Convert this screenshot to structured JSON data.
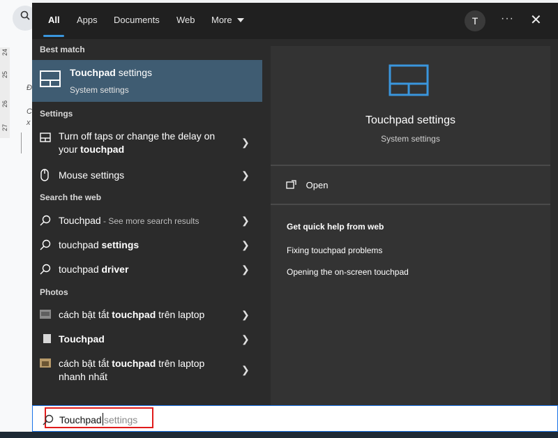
{
  "background": {
    "ruler_numbers": [
      "24",
      "25",
      "26",
      "27"
    ],
    "fragments": [
      "Đ",
      "C",
      "x"
    ]
  },
  "top_tabs": [
    {
      "label": "All"
    },
    {
      "label": "Apps"
    },
    {
      "label": "Documents"
    },
    {
      "label": "Web"
    },
    {
      "label": "More"
    }
  ],
  "avatar_initial": "T",
  "best_match": {
    "heading": "Best match",
    "title_bold": "Touchpad",
    "title_rest": " settings",
    "subtitle": "System settings"
  },
  "settings": {
    "heading": "Settings",
    "items": [
      {
        "text_pre": "Turn off taps or change the delay on your ",
        "text_bold": "touchpad"
      },
      {
        "text_pre": "Mouse settings",
        "text_bold": ""
      }
    ]
  },
  "search_web": {
    "heading": "Search the web",
    "items": [
      {
        "bold": "",
        "normal": "Touchpad",
        "sub": " - See more search results"
      },
      {
        "normal": "touchpad ",
        "bold": "settings"
      },
      {
        "normal": "touchpad ",
        "bold": "driver"
      }
    ]
  },
  "photos": {
    "heading": "Photos",
    "items": [
      {
        "pre": "cách bật tắt ",
        "bold": "touchpad",
        "post": " trên laptop"
      },
      {
        "pre": "",
        "bold": "Touchpad",
        "post": ""
      },
      {
        "pre": "cách bật tắt ",
        "bold": "touchpad",
        "post": " trên laptop nhanh nhất"
      }
    ]
  },
  "detail": {
    "title": "Touchpad settings",
    "subtitle": "System settings",
    "open_label": "Open",
    "help_heading": "Get quick help from web",
    "help_links": [
      "Fixing touchpad problems",
      "Opening the on-screen touchpad"
    ]
  },
  "search": {
    "typed": "Touchpad",
    "suggestion": "settings"
  },
  "colors": {
    "accent": "#3a96dd",
    "selected_row": "#3f5c72",
    "highlight_box": "#e01b1b"
  }
}
